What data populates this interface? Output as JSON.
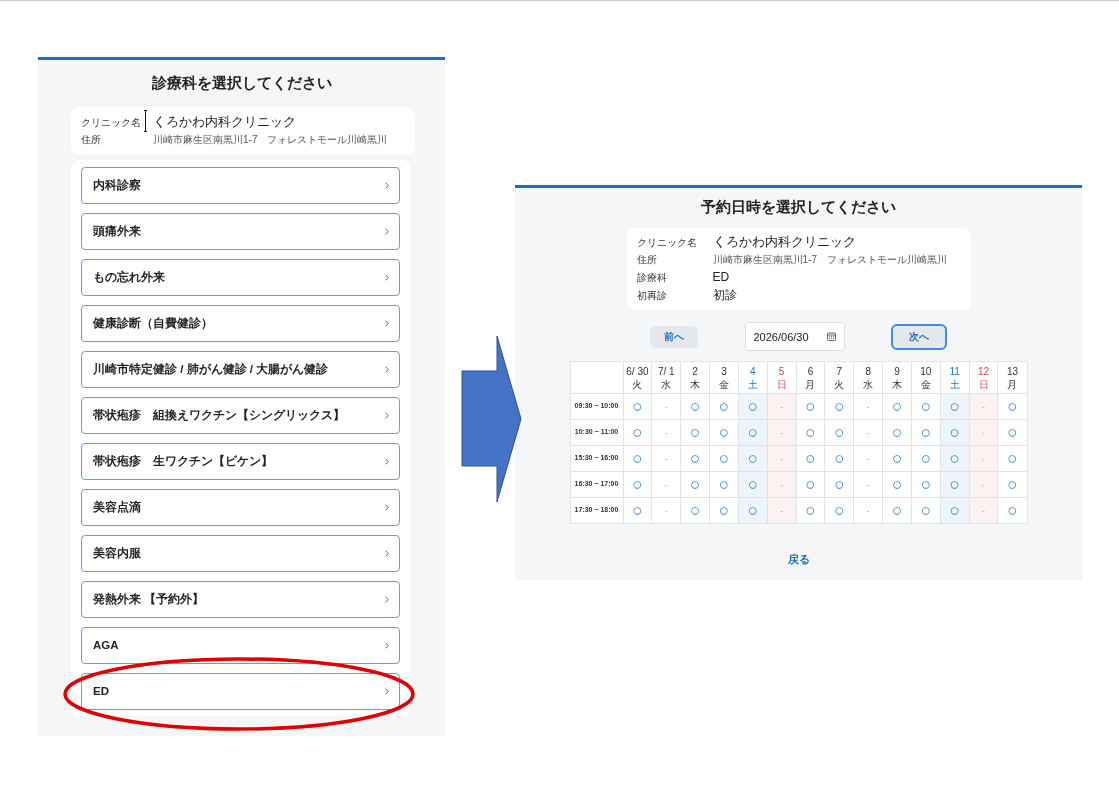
{
  "department_screen": {
    "title": "診療科を選択してください",
    "clinic_info": [
      {
        "label": "クリニック名",
        "value": "くろかわ内科クリニック",
        "kind": "name"
      },
      {
        "label": "住所",
        "value": "川崎市麻生区南黒川1-7　フォレストモール川崎黒川",
        "kind": "address"
      }
    ],
    "departments": [
      {
        "label": "内科診察",
        "highlighted": false
      },
      {
        "label": "頭痛外来",
        "highlighted": false
      },
      {
        "label": "もの忘れ外来",
        "highlighted": false
      },
      {
        "label": "健康診断（自費健診）",
        "highlighted": false
      },
      {
        "label": "川崎市特定健診 / 肺がん健診 / 大腸がん健診",
        "highlighted": false
      },
      {
        "label": "帯状疱疹　組換えワクチン【シングリックス】",
        "highlighted": false
      },
      {
        "label": "帯状疱疹　生ワクチン【ビケン】",
        "highlighted": false
      },
      {
        "label": "美容点滴",
        "highlighted": false
      },
      {
        "label": "美容内服",
        "highlighted": false
      },
      {
        "label": "発熱外来 【予約外】",
        "highlighted": false
      },
      {
        "label": "AGA",
        "highlighted": false
      },
      {
        "label": "ED",
        "highlighted": true
      }
    ]
  },
  "datetime_screen": {
    "title": "予約日時を選択してください",
    "summary": [
      {
        "label": "クリニック名",
        "value": "くろかわ内科クリニック",
        "kind": "name"
      },
      {
        "label": "住所",
        "value": "川崎市麻生区南黒川1-7　フォレストモール川崎黒川",
        "kind": "address"
      },
      {
        "label": "診療科",
        "value": "ED",
        "kind": "value"
      },
      {
        "label": "初再診",
        "value": "初診",
        "kind": "value"
      }
    ],
    "prev_button": "前へ",
    "date": "2026/06/30",
    "next_button": {
      "label": "次へ",
      "focused": true
    },
    "schedule": {
      "columns": [
        {
          "date": "6/ 30",
          "weekday": "火",
          "kind": "weekday"
        },
        {
          "date": "7/ 1",
          "weekday": "水",
          "kind": "weekday"
        },
        {
          "date": "2",
          "weekday": "木",
          "kind": "weekday"
        },
        {
          "date": "3",
          "weekday": "金",
          "kind": "weekday"
        },
        {
          "date": "4",
          "weekday": "土",
          "kind": "saturday"
        },
        {
          "date": "5",
          "weekday": "日",
          "kind": "sunday"
        },
        {
          "date": "6",
          "weekday": "月",
          "kind": "weekday"
        },
        {
          "date": "7",
          "weekday": "火",
          "kind": "weekday"
        },
        {
          "date": "8",
          "weekday": "水",
          "kind": "weekday"
        },
        {
          "date": "9",
          "weekday": "木",
          "kind": "weekday"
        },
        {
          "date": "10",
          "weekday": "金",
          "kind": "weekday"
        },
        {
          "date": "11",
          "weekday": "土",
          "kind": "saturday"
        },
        {
          "date": "12",
          "weekday": "日",
          "kind": "sunday"
        },
        {
          "date": "13",
          "weekday": "月",
          "kind": "weekday"
        }
      ],
      "rows": [
        {
          "time": "09:30 ~ 10:00",
          "cells": [
            {
              "text": "○",
              "available": true
            },
            {
              "text": "-",
              "available": false
            },
            {
              "text": "○",
              "available": true
            },
            {
              "text": "○",
              "available": true
            },
            {
              "text": "○",
              "available": true
            },
            {
              "text": "-",
              "available": false
            },
            {
              "text": "○",
              "available": true
            },
            {
              "text": "○",
              "available": true
            },
            {
              "text": "-",
              "available": false
            },
            {
              "text": "○",
              "available": true
            },
            {
              "text": "○",
              "available": true
            },
            {
              "text": "○",
              "available": true
            },
            {
              "text": "-",
              "available": false
            },
            {
              "text": "○",
              "available": true
            }
          ]
        },
        {
          "time": "10:30 ~ 11:00",
          "cells": [
            {
              "text": "○",
              "available": true
            },
            {
              "text": "-",
              "available": false
            },
            {
              "text": "○",
              "available": true
            },
            {
              "text": "○",
              "available": true
            },
            {
              "text": "○",
              "available": true
            },
            {
              "text": "-",
              "available": false
            },
            {
              "text": "○",
              "available": true
            },
            {
              "text": "○",
              "available": true
            },
            {
              "text": "-",
              "available": false
            },
            {
              "text": "○",
              "available": true
            },
            {
              "text": "○",
              "available": true
            },
            {
              "text": "○",
              "available": true
            },
            {
              "text": "-",
              "available": false
            },
            {
              "text": "○",
              "available": true
            }
          ]
        },
        {
          "time": "15:30 ~ 16:00",
          "cells": [
            {
              "text": "○",
              "available": true
            },
            {
              "text": "-",
              "available": false
            },
            {
              "text": "○",
              "available": true
            },
            {
              "text": "○",
              "available": true
            },
            {
              "text": "○",
              "available": true
            },
            {
              "text": "-",
              "available": false
            },
            {
              "text": "○",
              "available": true
            },
            {
              "text": "○",
              "available": true
            },
            {
              "text": "-",
              "available": false
            },
            {
              "text": "○",
              "available": true
            },
            {
              "text": "○",
              "available": true
            },
            {
              "text": "○",
              "available": true
            },
            {
              "text": "-",
              "available": false
            },
            {
              "text": "○",
              "available": true
            }
          ]
        },
        {
          "time": "16:30 ~ 17:00",
          "cells": [
            {
              "text": "○",
              "available": true
            },
            {
              "text": "-",
              "available": false
            },
            {
              "text": "○",
              "available": true
            },
            {
              "text": "○",
              "available": true
            },
            {
              "text": "○",
              "available": true
            },
            {
              "text": "-",
              "available": false
            },
            {
              "text": "○",
              "available": true
            },
            {
              "text": "○",
              "available": true
            },
            {
              "text": "-",
              "available": false
            },
            {
              "text": "○",
              "available": true
            },
            {
              "text": "○",
              "available": true
            },
            {
              "text": "○",
              "available": true
            },
            {
              "text": "-",
              "available": false
            },
            {
              "text": "○",
              "available": true
            }
          ]
        },
        {
          "time": "17:30 ~ 18:00",
          "cells": [
            {
              "text": "○",
              "available": true
            },
            {
              "text": "-",
              "available": false
            },
            {
              "text": "○",
              "available": true
            },
            {
              "text": "○",
              "available": true
            },
            {
              "text": "○",
              "available": true
            },
            {
              "text": "-",
              "available": false
            },
            {
              "text": "○",
              "available": true
            },
            {
              "text": "○",
              "available": true
            },
            {
              "text": "-",
              "available": false
            },
            {
              "text": "○",
              "available": true
            },
            {
              "text": "○",
              "available": true
            },
            {
              "text": "○",
              "available": true
            },
            {
              "text": "-",
              "available": false
            },
            {
              "text": "○",
              "available": true
            }
          ]
        }
      ]
    },
    "back_link": "戻る"
  }
}
